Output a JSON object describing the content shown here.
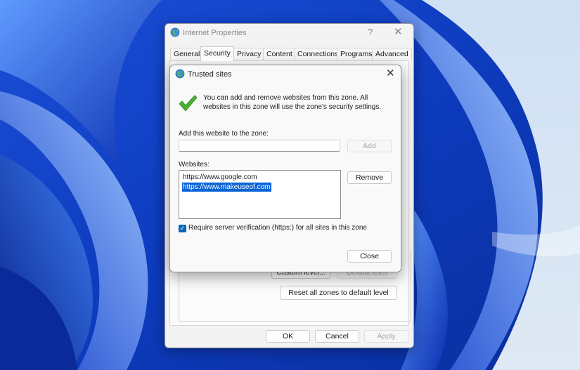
{
  "internet_properties": {
    "title": "Internet Properties",
    "help_glyph": "?",
    "close_glyph": "✕",
    "tabs": [
      "General",
      "Security",
      "Privacy",
      "Content",
      "Connections",
      "Programs",
      "Advanced"
    ],
    "active_tab": "Security",
    "custom_level_label": "Custom level...",
    "default_level_label": "Default level",
    "reset_all_label": "Reset all zones to default level",
    "ok_label": "OK",
    "cancel_label": "Cancel",
    "apply_label": "Apply"
  },
  "trusted_sites": {
    "title": "Trusted sites",
    "close_glyph": "✕",
    "info_text": "You can add and remove websites from this zone. All websites in this zone will use the zone's security settings.",
    "add_label": "Add this website to the zone:",
    "add_input_value": "",
    "add_button": "Add",
    "websites_label": "Websites:",
    "websites": [
      "https://www.google.com",
      "https://www.makeuseof.com"
    ],
    "selected_index": 1,
    "remove_button": "Remove",
    "require_https_label": "Require server verification (https:) for all sites in this zone",
    "require_https_checked": true,
    "close_button": "Close"
  },
  "colors": {
    "accent": "#0a64d6",
    "check_green": "#4caf2f",
    "wallpaper_base": "#0b3fc8"
  },
  "icons": {
    "window_icon": "globe-icon",
    "info_icon": "checkmark-icon"
  }
}
